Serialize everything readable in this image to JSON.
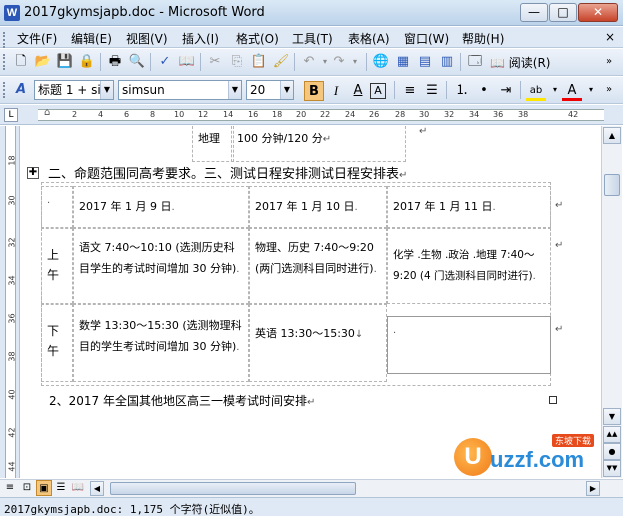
{
  "window": {
    "title": "2017gkymsjapb.doc - Microsoft Word",
    "app_icon": "W",
    "min": "—",
    "max": "□",
    "close": "✕"
  },
  "menu": {
    "items": [
      "文件(F)",
      "编辑(E)",
      "视图(V)",
      "插入(I)",
      "格式(O)",
      "工具(T)",
      "表格(A)",
      "窗口(W)",
      "帮助(H)"
    ],
    "close": "×"
  },
  "toolbar": {
    "read_label": "阅读(R)"
  },
  "format_bar": {
    "style": "标题 1 + si",
    "font": "simsun",
    "size": "20",
    "bold": "B",
    "italic": "I",
    "underline_a": "A",
    "char_border": "A",
    "highlight": "ab",
    "font_color": "A"
  },
  "ruler": {
    "marks": [
      "2",
      "4",
      "6",
      "8",
      "10",
      "12",
      "14",
      "16",
      "18",
      "20",
      "22",
      "24",
      "26",
      "28",
      "30",
      "32",
      "34",
      "36",
      "38",
      "42"
    ]
  },
  "vruler": {
    "marks": [
      "18",
      "30",
      "32",
      "34",
      "36",
      "38",
      "40",
      "42",
      "44"
    ]
  },
  "document": {
    "top_row": {
      "subject": "地理",
      "duration": "100 分钟/120 分"
    },
    "heading1": "二、命题范围同高考要求。三、测试日程安排测试日程安排表",
    "table": {
      "headers": [
        "",
        "2017 年 1 月 9 日",
        "2017 年 1 月 10 日",
        "2017 年 1 月 11 日"
      ],
      "rows": [
        {
          "period": "上午",
          "day1": "语文 7:40～10:10 (选测历史科目学生的考试时间增加 30 分钟)",
          "day2": "物理、历史 7:40～9:20 (两门选测科目同时进行)",
          "day3": "化学 .生物 .政治 .地理 7:40～9:20 (4 门选测科目同时进行)"
        },
        {
          "period": "下午",
          "day1": "数学 13:30～15:30 (选测物理科目的学生考试时间增加 30 分钟)",
          "day2": "英语 13:30～15:30",
          "day3": ""
        }
      ]
    },
    "heading2": "2、2017 年全国其他地区高三一模考试时间安排"
  },
  "status": {
    "text": "2017gkymsjapb.doc: 1,175 个字符(近似值)。"
  },
  "watermark": {
    "text": "uzzf.com",
    "sub": "东坡下载"
  }
}
